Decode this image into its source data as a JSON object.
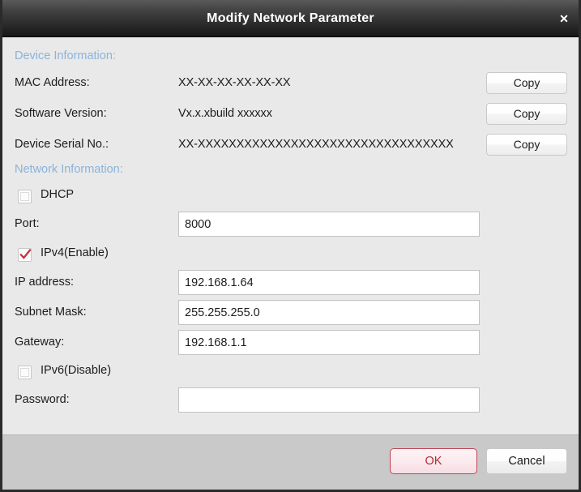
{
  "window": {
    "title": "Modify Network Parameter",
    "close_label": "✕"
  },
  "device_information": {
    "heading": "Device Information:",
    "rows": [
      {
        "label": "MAC Address:",
        "value": "XX-XX-XX-XX-XX-XX",
        "button": "Copy"
      },
      {
        "label": "Software Version:",
        "value": "Vx.x.xbuild xxxxxx",
        "button": "Copy"
      },
      {
        "label": "Device Serial No.:",
        "value": "XX-XXXXXXXXXXXXXXXXXXXXXXXXXXXXXXXXX",
        "button": "Copy"
      }
    ]
  },
  "network_information": {
    "heading": "Network Information:",
    "dhcp": {
      "label": "DHCP",
      "checked": false
    },
    "port": {
      "label": "Port:",
      "value": "8000",
      "placeholder": ""
    },
    "ipv4": {
      "label": "IPv4(Enable)",
      "checked": true
    },
    "ip_address": {
      "label": "IP address:",
      "value": "192.168.1.64",
      "placeholder": ""
    },
    "subnet_mask": {
      "label": "Subnet Mask:",
      "value": "255.255.255.0",
      "placeholder": ""
    },
    "gateway": {
      "label": "Gateway:",
      "value": "192.168.1.1",
      "placeholder": ""
    },
    "ipv6": {
      "label": "IPv6(Disable)",
      "checked": false
    },
    "password": {
      "label": "Password:",
      "value": "",
      "placeholder": ""
    }
  },
  "footer": {
    "ok_label": "OK",
    "cancel_label": "Cancel"
  },
  "colors": {
    "titlebar_top": "#5a5a5a",
    "titlebar_bottom": "#161616",
    "section_heading": "#8cb3da",
    "accent_red": "#bf4455",
    "body_bg": "#e9e9e9",
    "footer_bg": "#c9c9c9"
  }
}
